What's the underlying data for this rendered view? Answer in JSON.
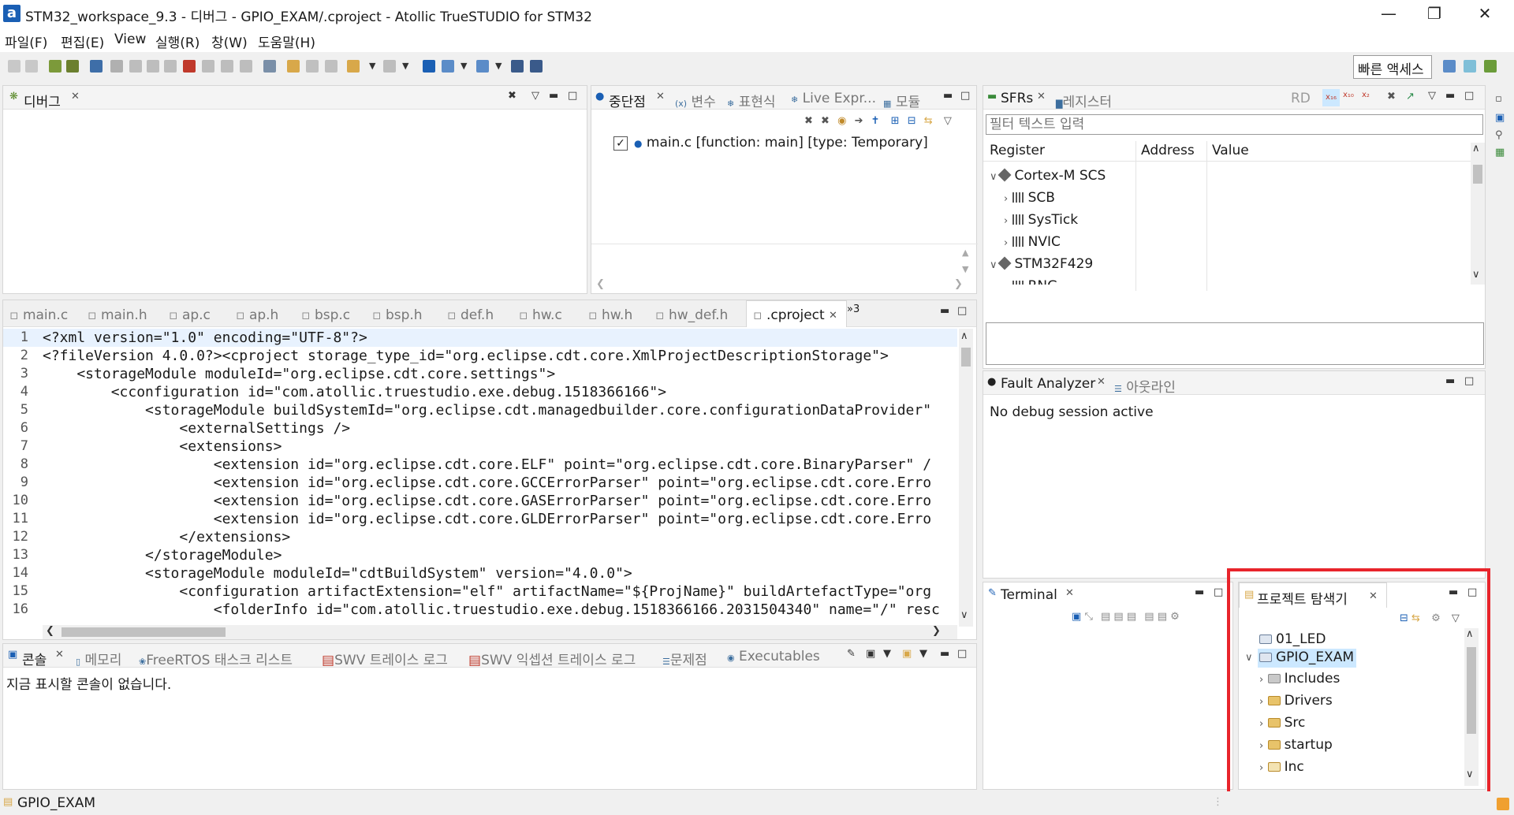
{
  "window": {
    "title": "STM32_workspace_9.3 - 디버그 - GPIO_EXAM/.cproject - Atollic TrueSTUDIO for STM32",
    "app_icon": "a"
  },
  "menu": [
    "파일(F)",
    "편집(E)",
    "View",
    "실행(R)",
    "창(W)",
    "도움말(H)"
  ],
  "quick_access": "빠른 액세스",
  "debug_view": {
    "tab": "디버그"
  },
  "breakpoints_view": {
    "tabs": [
      "중단점",
      "변수",
      "표현식",
      "Live Expr...",
      "모듈"
    ],
    "items": [
      {
        "checked": true,
        "label": "main.c [function: main] [type: Temporary]"
      }
    ]
  },
  "sfr_view": {
    "tabs": [
      "SFRs",
      "레지스터"
    ],
    "rd": "RD",
    "filter_placeholder": "필터 텍스트 입력",
    "columns": [
      "Register",
      "Address",
      "Value"
    ],
    "rows": [
      "Cortex-M SCS",
      "SCB",
      "SysTick",
      "NVIC",
      "STM32F429",
      "RNG"
    ]
  },
  "editor": {
    "tabs": [
      "main.c",
      "main.h",
      "ap.c",
      "ap.h",
      "bsp.c",
      "bsp.h",
      "def.h",
      "hw.c",
      "hw.h",
      "hw_def.h",
      ".cproject"
    ],
    "overflow": "»3",
    "lines": [
      "<?xml version=\"1.0\" encoding=\"UTF-8\"?>",
      "<?fileVersion 4.0.0?><cproject storage_type_id=\"org.eclipse.cdt.core.XmlProjectDescriptionStorage\">",
      "    <storageModule moduleId=\"org.eclipse.cdt.core.settings\">",
      "        <cconfiguration id=\"com.atollic.truestudio.exe.debug.1518366166\">",
      "            <storageModule buildSystemId=\"org.eclipse.cdt.managedbuilder.core.configurationDataProvider\"",
      "                <externalSettings />",
      "                <extensions>",
      "                    <extension id=\"org.eclipse.cdt.core.ELF\" point=\"org.eclipse.cdt.core.BinaryParser\" /",
      "                    <extension id=\"org.eclipse.cdt.core.GCCErrorParser\" point=\"org.eclipse.cdt.core.Erro",
      "                    <extension id=\"org.eclipse.cdt.core.GASErrorParser\" point=\"org.eclipse.cdt.core.Erro",
      "                    <extension id=\"org.eclipse.cdt.core.GLDErrorParser\" point=\"org.eclipse.cdt.core.Erro",
      "                </extensions>",
      "            </storageModule>",
      "            <storageModule moduleId=\"cdtBuildSystem\" version=\"4.0.0\">",
      "                <configuration artifactExtension=\"elf\" artifactName=\"${ProjName}\" buildArtefactType=\"org",
      "                    <folderInfo id=\"com.atollic.truestudio.exe.debug.1518366166.2031504340\" name=\"/\" resc"
    ],
    "line_numbers": [
      "1",
      "2",
      "3",
      "4",
      "5",
      "6",
      "7",
      "8",
      "9",
      "10",
      "11",
      "12",
      "13",
      "14",
      "15",
      "16"
    ]
  },
  "fault_view": {
    "tabs": [
      "Fault Analyzer",
      "아웃라인"
    ],
    "message": "No debug session active"
  },
  "console_view": {
    "tabs": [
      "콘솔",
      "메모리",
      "FreeRTOS 태스크 리스트",
      "SWV 트레이스 로그",
      "SWV 익셉션 트레이스 로그",
      "문제점",
      "Executables"
    ],
    "message": "지금 표시할 콘솔이 없습니다."
  },
  "terminal_view": {
    "tab": "Terminal"
  },
  "explorer_view": {
    "tab": "프로젝트 탐색기",
    "items": [
      "01_LED",
      "GPIO_EXAM",
      "Includes",
      "Drivers",
      "Src",
      "startup",
      "Inc"
    ]
  },
  "status_bar": {
    "text": "GPIO_EXAM"
  },
  "colors": {
    "highlight": "#e8242b",
    "selection": "#cce8ff",
    "accent": "#1a5fb4"
  }
}
